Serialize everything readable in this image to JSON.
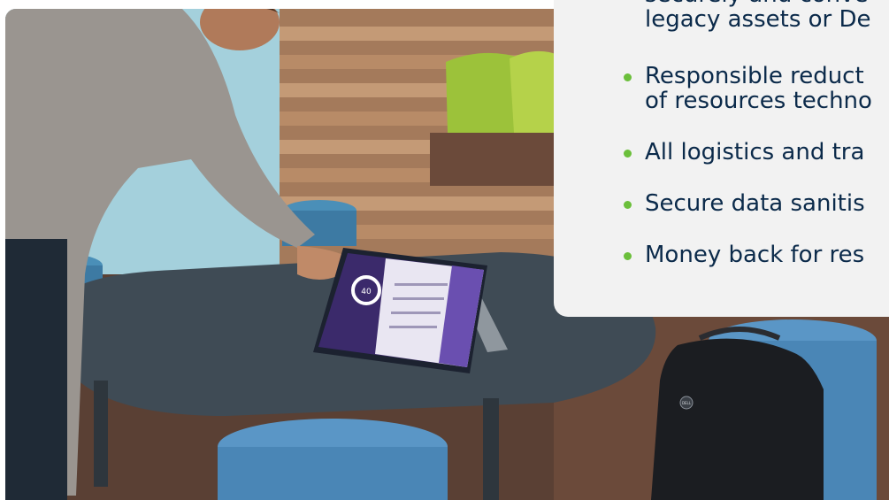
{
  "callout": {
    "bullets": [
      {
        "lines": [
          "securely and conve",
          "legacy assets or De"
        ]
      },
      {
        "lines": [
          "Responsible reduct",
          "of resources techno"
        ]
      },
      {
        "lines": [
          "All logistics and tra"
        ]
      },
      {
        "lines": [
          "Secure data sanitis"
        ]
      },
      {
        "lines": [
          "Money back for res"
        ]
      }
    ]
  },
  "photo": {
    "tablet_screen_value": "40",
    "bag_logo": "DELL"
  },
  "colors": {
    "accent_green": "#6bbf3b",
    "text_navy": "#0b2a4a",
    "callout_bg": "#f2f2f2"
  }
}
